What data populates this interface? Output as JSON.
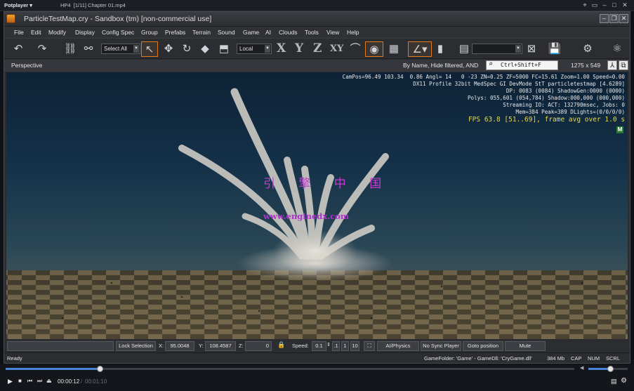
{
  "player": {
    "brand": "Potplayer",
    "format": "HP4",
    "file_label": "[1/11] Chapter 01.mp4",
    "time_current": "00:00:12",
    "time_total": "00:01:10",
    "progress": 0.165,
    "volume": 0.55
  },
  "window": {
    "title": "ParticleTestMap.cry - Sandbox (tm) [non-commercial use]"
  },
  "menu": [
    "File",
    "Edit",
    "Modify",
    "Display",
    "Config Spec",
    "Group",
    "Prefabs",
    "Terrain",
    "Sound",
    "Game",
    "AI",
    "Clouds",
    "Tools",
    "View",
    "Help"
  ],
  "toolbar": {
    "select_all": "Select All",
    "coord_space": "Local",
    "axes": [
      "X",
      "Y",
      "Z",
      "XY"
    ]
  },
  "viewport_header": {
    "mode": "Perspective",
    "filter": "By Name, Hide filtered, AND",
    "search": "Ctrl+Shift+F",
    "resolution": "1275 x 549"
  },
  "viewport": {
    "stats": [
      "CamPos=96.49 103.34  0.86 Angl= 14   0 -23 ZN=0.25 ZF=5000 FC=15.61 Zoom=1.00 Speed=0.00",
      "DX11 Profile 32bit MedSpec GI DevMode StT particletestmap [4.6289]",
      "DP: 0083 (0084) ShadowGen:0000 (0000)",
      "Polys: 055,601 (054,784) Shadow:000,000 (000,000)",
      "Streaming IO: ACT: 132790msec, Jobs: 0",
      "Mem=384 Peak=389 DLights=(0/0/0/0)"
    ],
    "fps": "FPS 63.8 [51..69], frame avg over 1.0 s",
    "badge": "M",
    "watermark_cn": "引 擎 中 国",
    "watermark_url": "www.enginedx.com"
  },
  "statusbar": {
    "lock_selection": "Lock Selection",
    "x_label": "X:",
    "x_value": "95.0048",
    "y_label": "Y:",
    "y_value": "108.4587",
    "z_label": "Z:",
    "z_value": "0",
    "speed_label": "Speed:",
    "speed_value": "0.1",
    "speed_presets": [
      ".1",
      "1",
      "10"
    ],
    "ai_physics": "AI/Physics",
    "no_sync": "No Sync Player",
    "goto": "Goto position",
    "mute": "Mute"
  },
  "readybar": {
    "ready": "Ready",
    "game_info": "GameFolder: 'Game' - GameDll: 'CryGame.dll'",
    "mem": "384 Mb",
    "cap": "CAP",
    "num": "NUM",
    "scrl": "SCRL"
  }
}
